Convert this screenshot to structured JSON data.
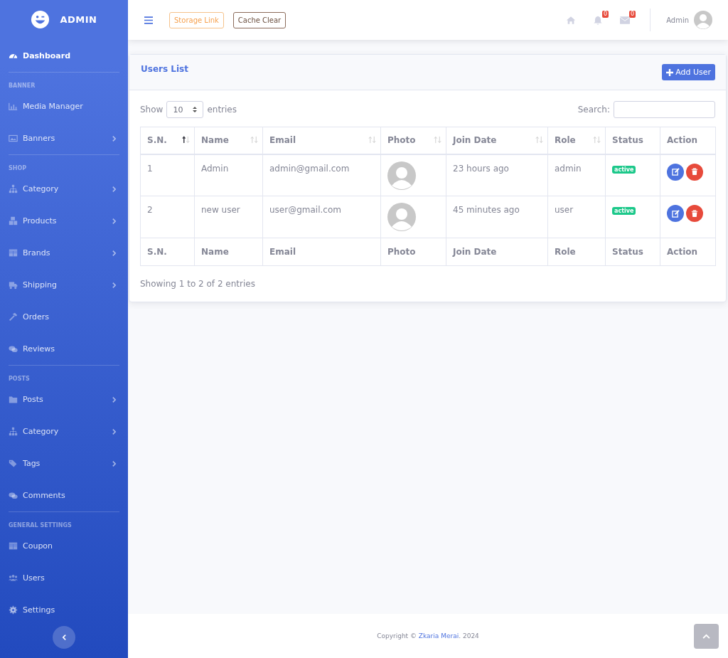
{
  "sidebar": {
    "brand": "ADMIN",
    "sections": [
      {
        "items": [
          {
            "label": "Dashboard",
            "selected": true,
            "has_submenu": false
          }
        ]
      },
      {
        "heading": "BANNER",
        "items": [
          {
            "label": "Media Manager",
            "selected": false,
            "has_submenu": false
          },
          {
            "label": "Banners",
            "selected": false,
            "has_submenu": true
          }
        ]
      },
      {
        "heading": "SHOP",
        "items": [
          {
            "label": "Category",
            "selected": false,
            "has_submenu": true
          },
          {
            "label": "Products",
            "selected": false,
            "has_submenu": true
          },
          {
            "label": "Brands",
            "selected": false,
            "has_submenu": true
          },
          {
            "label": "Shipping",
            "selected": false,
            "has_submenu": true
          },
          {
            "label": "Orders",
            "selected": false,
            "has_submenu": false
          },
          {
            "label": "Reviews",
            "selected": false,
            "has_submenu": false
          }
        ]
      },
      {
        "heading": "POSTS",
        "items": [
          {
            "label": "Posts",
            "selected": false,
            "has_submenu": true
          },
          {
            "label": "Category",
            "selected": false,
            "has_submenu": true
          },
          {
            "label": "Tags",
            "selected": false,
            "has_submenu": true
          },
          {
            "label": "Comments",
            "selected": false,
            "has_submenu": false
          }
        ]
      },
      {
        "heading": "GENERAL SETTINGS",
        "items": [
          {
            "label": "Coupon",
            "selected": false,
            "has_submenu": false
          },
          {
            "label": "Users",
            "selected": false,
            "has_submenu": false
          },
          {
            "label": "Settings",
            "selected": false,
            "has_submenu": false
          }
        ]
      }
    ]
  },
  "topbar": {
    "buttons": [
      {
        "label": "Storage Link",
        "kind": "warning"
      },
      {
        "label": "Cache Clear",
        "kind": "brown"
      }
    ],
    "alerts_count": "0",
    "messages_count": "0",
    "user_name": "Admin"
  },
  "card": {
    "title": "Users List",
    "add_button": "Add User",
    "length_prefix": "Show",
    "length_value": "10",
    "length_suffix": "entries",
    "search_label": "Search:",
    "columns": [
      {
        "label": "S.N.",
        "sortable": true,
        "sorted": true
      },
      {
        "label": "Name",
        "sortable": true,
        "sorted": false
      },
      {
        "label": "Email",
        "sortable": true,
        "sorted": false
      },
      {
        "label": "Photo",
        "sortable": true,
        "sorted": false
      },
      {
        "label": "Join Date",
        "sortable": true,
        "sorted": false
      },
      {
        "label": "Role",
        "sortable": true,
        "sorted": false
      },
      {
        "label": "Status",
        "sortable": false
      },
      {
        "label": "Action",
        "sortable": false
      }
    ],
    "rows": [
      {
        "sn": "1",
        "name": "Admin",
        "email": "admin@gmail.com",
        "join_date": "23 hours ago",
        "role": "admin",
        "status": "active"
      },
      {
        "sn": "2",
        "name": "new user",
        "email": "user@gmail.com",
        "join_date": "45 minutes ago",
        "role": "user",
        "status": "active"
      }
    ],
    "footer": [
      "S.N.",
      "Name",
      "Email",
      "Photo",
      "Join Date",
      "Role",
      "Status",
      "Action"
    ],
    "info": "Showing 1 to 2 of 2 entries"
  },
  "footer": {
    "prefix": "Copyright ©",
    "link": "Zkaria Merai",
    "suffix": ". 2024"
  }
}
